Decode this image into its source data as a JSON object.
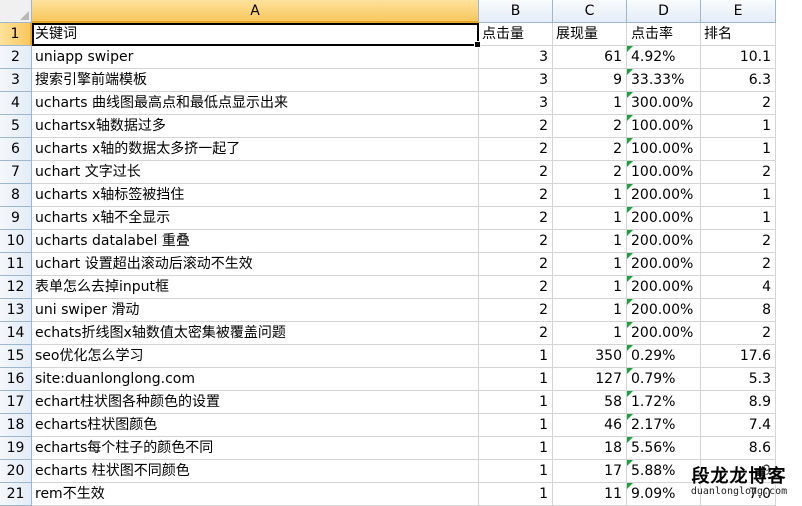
{
  "columns": [
    "A",
    "B",
    "C",
    "D",
    "E"
  ],
  "header_row": {
    "num": "1",
    "a": "关键词",
    "b": "点击量",
    "c": "展现量",
    "d": "点击率",
    "e": "排名"
  },
  "rows": [
    {
      "num": "2",
      "a": "uniapp swiper",
      "b": "3",
      "c": "61",
      "d": "4.92%",
      "e": "10.1"
    },
    {
      "num": "3",
      "a": "搜索引擎前端模板",
      "b": "3",
      "c": "9",
      "d": "33.33%",
      "e": "6.3"
    },
    {
      "num": "4",
      "a": "ucharts 曲线图最高点和最低点显示出来",
      "b": "3",
      "c": "1",
      "d": "300.00%",
      "e": "2"
    },
    {
      "num": "5",
      "a": "uchartsx轴数据过多",
      "b": "2",
      "c": "2",
      "d": "100.00%",
      "e": "1"
    },
    {
      "num": "6",
      "a": "ucharts x轴的数据太多挤一起了",
      "b": "2",
      "c": "2",
      "d": "100.00%",
      "e": "1"
    },
    {
      "num": "7",
      "a": "uchart 文字过长",
      "b": "2",
      "c": "2",
      "d": "100.00%",
      "e": "2"
    },
    {
      "num": "8",
      "a": "ucharts x轴标签被挡住",
      "b": "2",
      "c": "1",
      "d": "200.00%",
      "e": "1"
    },
    {
      "num": "9",
      "a": "ucharts x轴不全显示",
      "b": "2",
      "c": "1",
      "d": "200.00%",
      "e": "1"
    },
    {
      "num": "10",
      "a": "ucharts datalabel 重叠",
      "b": "2",
      "c": "1",
      "d": "200.00%",
      "e": "2"
    },
    {
      "num": "11",
      "a": "uchart 设置超出滚动后滚动不生效",
      "b": "2",
      "c": "1",
      "d": "200.00%",
      "e": "2"
    },
    {
      "num": "12",
      "a": "表单怎么去掉input框",
      "b": "2",
      "c": "1",
      "d": "200.00%",
      "e": "4"
    },
    {
      "num": "13",
      "a": "uni swiper 滑动",
      "b": "2",
      "c": "1",
      "d": "200.00%",
      "e": "8"
    },
    {
      "num": "14",
      "a": "echats折线图x轴数值太密集被覆盖问题",
      "b": "2",
      "c": "1",
      "d": "200.00%",
      "e": "2"
    },
    {
      "num": "15",
      "a": "seo优化怎么学习",
      "b": "1",
      "c": "350",
      "d": "0.29%",
      "e": "17.6"
    },
    {
      "num": "16",
      "a": "site:duanlonglong.com",
      "b": "1",
      "c": "127",
      "d": "0.79%",
      "e": "5.3"
    },
    {
      "num": "17",
      "a": "echart柱状图各种颜色的设置",
      "b": "1",
      "c": "58",
      "d": "1.72%",
      "e": "8.9"
    },
    {
      "num": "18",
      "a": "echarts柱状图颜色",
      "b": "1",
      "c": "46",
      "d": "2.17%",
      "e": "7.4"
    },
    {
      "num": "19",
      "a": "echarts每个柱子的颜色不同",
      "b": "1",
      "c": "18",
      "d": "5.56%",
      "e": "8.6"
    },
    {
      "num": "20",
      "a": "echarts 柱状图不同颜色",
      "b": "1",
      "c": "17",
      "d": "5.88%",
      "e": "9"
    },
    {
      "num": "21",
      "a": "rem不生效",
      "b": "1",
      "c": "11",
      "d": "9.09%",
      "e": "7.0"
    }
  ],
  "watermark": {
    "title": "段龙龙博客",
    "url": "duanlonglong.com"
  },
  "colors": {
    "selected_header": "#f9c75e",
    "header_bg": "#e4ecf7",
    "gridline": "#d4d4d4",
    "error_triangle": "#1e9e3c"
  }
}
